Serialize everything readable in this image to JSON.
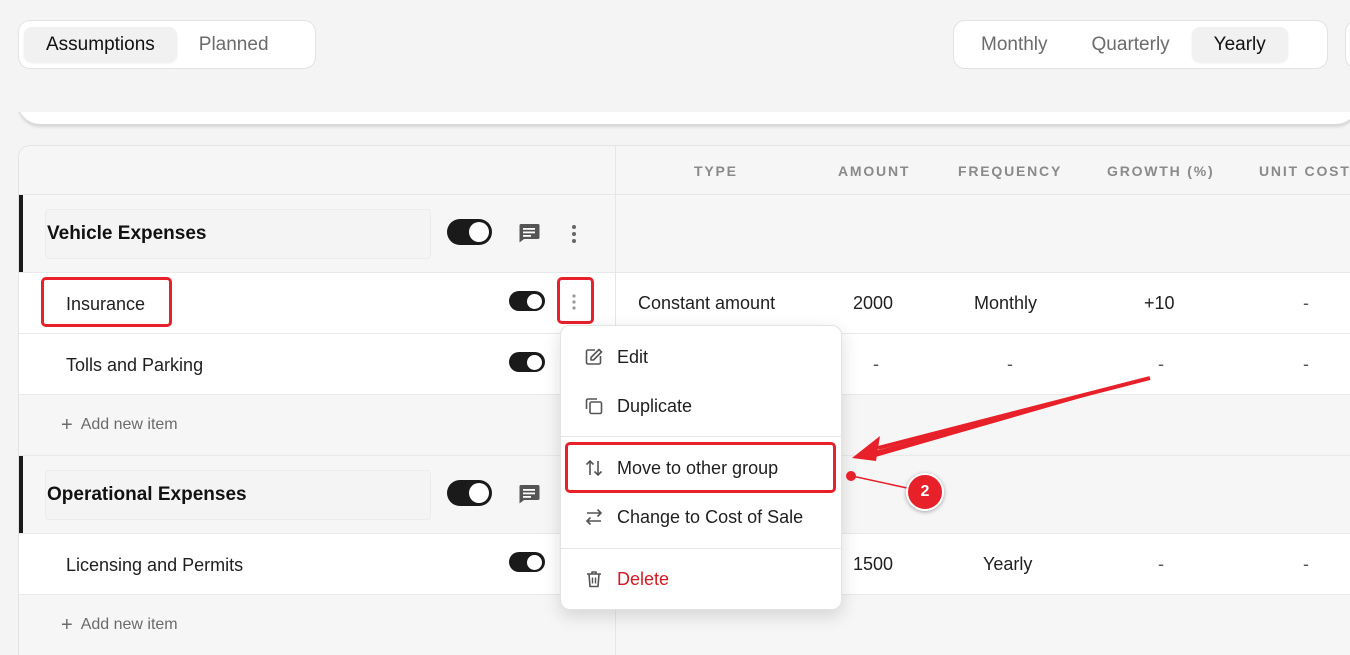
{
  "view_tabs": {
    "items": [
      "Assumptions",
      "Planned"
    ],
    "active": "Assumptions"
  },
  "period_tabs": {
    "items": [
      "Monthly",
      "Quarterly",
      "Yearly"
    ],
    "active": "Yearly"
  },
  "table": {
    "columns": [
      "TYPE",
      "AMOUNT",
      "FREQUENCY",
      "GROWTH (%)",
      "UNIT COST"
    ],
    "groups": [
      {
        "name": "Vehicle Expenses",
        "items": [
          {
            "name": "Insurance",
            "type": "Constant amount",
            "amount": "2000",
            "frequency": "Monthly",
            "growth": "+10",
            "unit_cost": "-"
          },
          {
            "name": "Tolls and Parking",
            "type": "",
            "amount": "-",
            "frequency": "-",
            "growth": "-",
            "unit_cost": "-"
          }
        ],
        "add_label": "Add new item"
      },
      {
        "name": "Operational Expenses",
        "items": [
          {
            "name": "Licensing and Permits",
            "type": "",
            "amount": "1500",
            "frequency": "Yearly",
            "growth": "-",
            "unit_cost": "-"
          }
        ],
        "add_label": "Add new item"
      }
    ]
  },
  "context_menu": {
    "edit": "Edit",
    "duplicate": "Duplicate",
    "move": "Move to other group",
    "change": "Change to Cost of Sale",
    "delete": "Delete"
  },
  "annotation": {
    "step": "2"
  },
  "colors": {
    "highlight": "#e8202a",
    "danger": "#d11a22",
    "toggle": "#1a1a1a"
  }
}
